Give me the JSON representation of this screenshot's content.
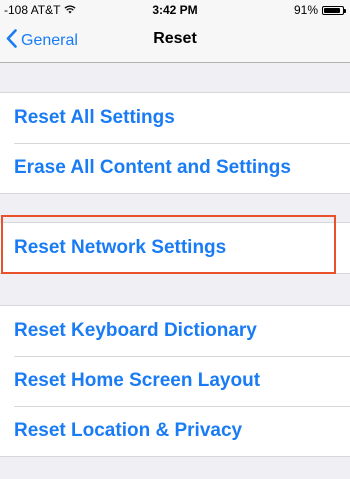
{
  "status_bar": {
    "carrier": "-108 AT&T",
    "time": "3:42 PM",
    "battery_percent": "91%",
    "battery_level": 0.91
  },
  "nav": {
    "back_label": "General",
    "title": "Reset"
  },
  "groups": [
    {
      "items": [
        {
          "label": "Reset All Settings"
        },
        {
          "label": "Erase All Content and Settings"
        }
      ]
    },
    {
      "items": [
        {
          "label": "Reset Network Settings"
        }
      ]
    },
    {
      "items": [
        {
          "label": "Reset Keyboard Dictionary"
        },
        {
          "label": "Reset Home Screen Layout"
        },
        {
          "label": "Reset Location & Privacy"
        }
      ]
    }
  ],
  "colors": {
    "accent": "#1a7cf5",
    "highlight": "#e8512a",
    "background": "#efeff4"
  },
  "icons": [
    "signal-bars-icon",
    "wifi-icon",
    "battery-icon",
    "chevron-left-icon"
  ]
}
